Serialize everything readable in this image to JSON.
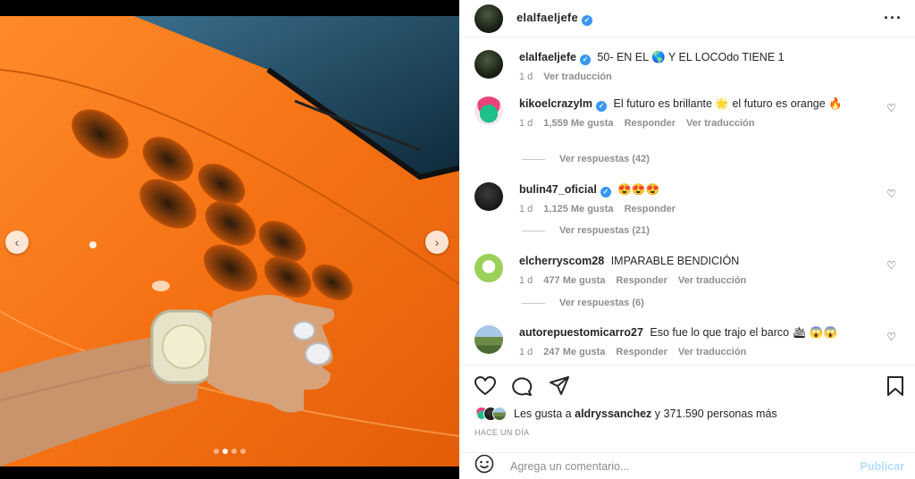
{
  "post": {
    "username": "elalfaeljefe",
    "caption": "50- EN EL 🌎 Y EL LOCOdo TIENE 1",
    "caption_time": "1 d",
    "caption_translate": "Ver traducción",
    "more_icon": "more-horizontal-icon"
  },
  "media": {
    "prev_icon": "chevron-left-icon",
    "next_icon": "chevron-right-icon",
    "prev_glyph": "‹",
    "next_glyph": "›",
    "slides": 4,
    "active_slide": 2
  },
  "comments": [
    {
      "username": "kikoelcrazylm",
      "verified": true,
      "text": "El futuro es brillante 🌟 el futuro es orange 🔥",
      "time": "1 d",
      "likes": "1,559 Me gusta",
      "reply": "Responder",
      "translate": "Ver traducción",
      "replies": "Ver respuestas (42)"
    },
    {
      "username": "bulin47_oficial",
      "verified": true,
      "text": "😍😍😍",
      "time": "1 d",
      "likes": "1,125 Me gusta",
      "reply": "Responder",
      "replies": "Ver respuestas (21)"
    },
    {
      "username": "elcherryscom28",
      "verified": false,
      "text": "IMPARABLE BENDICIÓN",
      "time": "1 d",
      "likes": "477 Me gusta",
      "reply": "Responder",
      "translate": "Ver traducción",
      "replies": "Ver respuestas (6)"
    },
    {
      "username": "autorepuestomicarro27",
      "verified": false,
      "text": "Eso fue lo que trajo el barco 🛳 😱😱",
      "time": "1 d",
      "likes": "247 Me gusta",
      "reply": "Responder",
      "translate": "Ver traducción"
    }
  ],
  "actions": {
    "like_icon": "heart-icon",
    "comment_icon": "comment-icon",
    "share_icon": "send-icon",
    "save_icon": "bookmark-icon"
  },
  "likes": {
    "prefix": "Les gusta a",
    "user": "aldryssanchez",
    "suffix": "y 371.590 personas más"
  },
  "time_ago": "HACE UN DÍA",
  "comment_bar": {
    "emoji_icon": "emoji-icon",
    "placeholder": "Agrega un comentario...",
    "publish": "Publicar"
  },
  "colors": {
    "accent": "#3897f0",
    "publish_disabled": "#b2dffc",
    "car_orange": "#f47a16"
  }
}
